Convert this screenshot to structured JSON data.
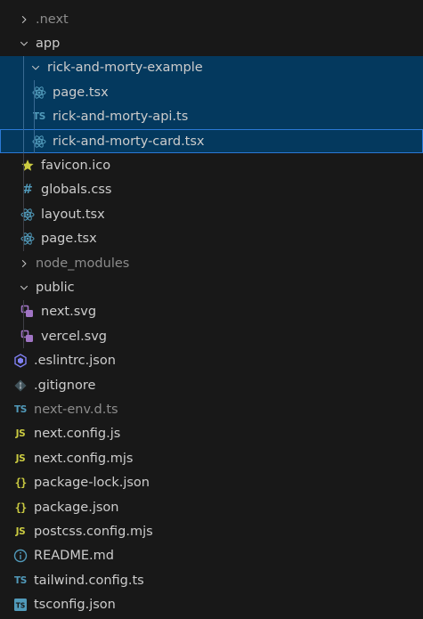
{
  "colors": {
    "background": "#181818",
    "selection": "#04395e",
    "focus_border": "#2b79d6",
    "text": "#cccccc",
    "dim_text": "#8c8c8c",
    "react_icon": "#519aba",
    "ts_icon": "#519aba",
    "js_icon": "#cbcb41",
    "json_icon": "#cbcb41",
    "star_icon": "#cbcb41",
    "svg_icon": "#a074c4"
  },
  "tree": [
    {
      "label": ".next",
      "depth": 0,
      "type": "folder",
      "expanded": false,
      "dim": true
    },
    {
      "label": "app",
      "depth": 0,
      "type": "folder",
      "expanded": true
    },
    {
      "label": "rick-and-morty-example",
      "depth": 1,
      "type": "folder",
      "expanded": true,
      "selected": true
    },
    {
      "label": "page.tsx",
      "depth": 2,
      "type": "file",
      "icon": "react-icon",
      "selected": true
    },
    {
      "label": "rick-and-morty-api.ts",
      "depth": 2,
      "type": "file",
      "icon": "typescript-icon",
      "icon_text": "TS",
      "selected": true
    },
    {
      "label": "rick-and-morty-card.tsx",
      "depth": 2,
      "type": "file",
      "icon": "react-icon",
      "selected": true,
      "focused": true
    },
    {
      "label": "favicon.ico",
      "depth": 1,
      "type": "file",
      "icon": "star-icon"
    },
    {
      "label": "globals.css",
      "depth": 1,
      "type": "file",
      "icon": "css-hash-icon",
      "icon_text": "#"
    },
    {
      "label": "layout.tsx",
      "depth": 1,
      "type": "file",
      "icon": "react-icon"
    },
    {
      "label": "page.tsx",
      "depth": 1,
      "type": "file",
      "icon": "react-icon"
    },
    {
      "label": "node_modules",
      "depth": 0,
      "type": "folder",
      "expanded": false,
      "dim": true
    },
    {
      "label": "public",
      "depth": 0,
      "type": "folder",
      "expanded": true
    },
    {
      "label": "next.svg",
      "depth": 1,
      "type": "file",
      "icon": "svg-file-icon"
    },
    {
      "label": "vercel.svg",
      "depth": 1,
      "type": "file",
      "icon": "svg-file-icon"
    },
    {
      "label": ".eslintrc.json",
      "depth": 0,
      "type": "file",
      "icon": "eslint-icon"
    },
    {
      "label": ".gitignore",
      "depth": 0,
      "type": "file",
      "icon": "git-icon"
    },
    {
      "label": "next-env.d.ts",
      "depth": 0,
      "type": "file",
      "icon": "typescript-icon",
      "icon_text": "TS",
      "dim": true
    },
    {
      "label": "next.config.js",
      "depth": 0,
      "type": "file",
      "icon": "javascript-icon",
      "icon_text": "JS"
    },
    {
      "label": "next.config.mjs",
      "depth": 0,
      "type": "file",
      "icon": "javascript-icon",
      "icon_text": "JS"
    },
    {
      "label": "package-lock.json",
      "depth": 0,
      "type": "file",
      "icon": "json-icon",
      "icon_text": "{}"
    },
    {
      "label": "package.json",
      "depth": 0,
      "type": "file",
      "icon": "json-icon",
      "icon_text": "{}"
    },
    {
      "label": "postcss.config.mjs",
      "depth": 0,
      "type": "file",
      "icon": "javascript-icon",
      "icon_text": "JS"
    },
    {
      "label": "README.md",
      "depth": 0,
      "type": "file",
      "icon": "info-icon"
    },
    {
      "label": "tailwind.config.ts",
      "depth": 0,
      "type": "file",
      "icon": "typescript-icon",
      "icon_text": "TS"
    },
    {
      "label": "tsconfig.json",
      "depth": 0,
      "type": "file",
      "icon": "tsconfig-icon",
      "icon_text": "TS"
    }
  ]
}
